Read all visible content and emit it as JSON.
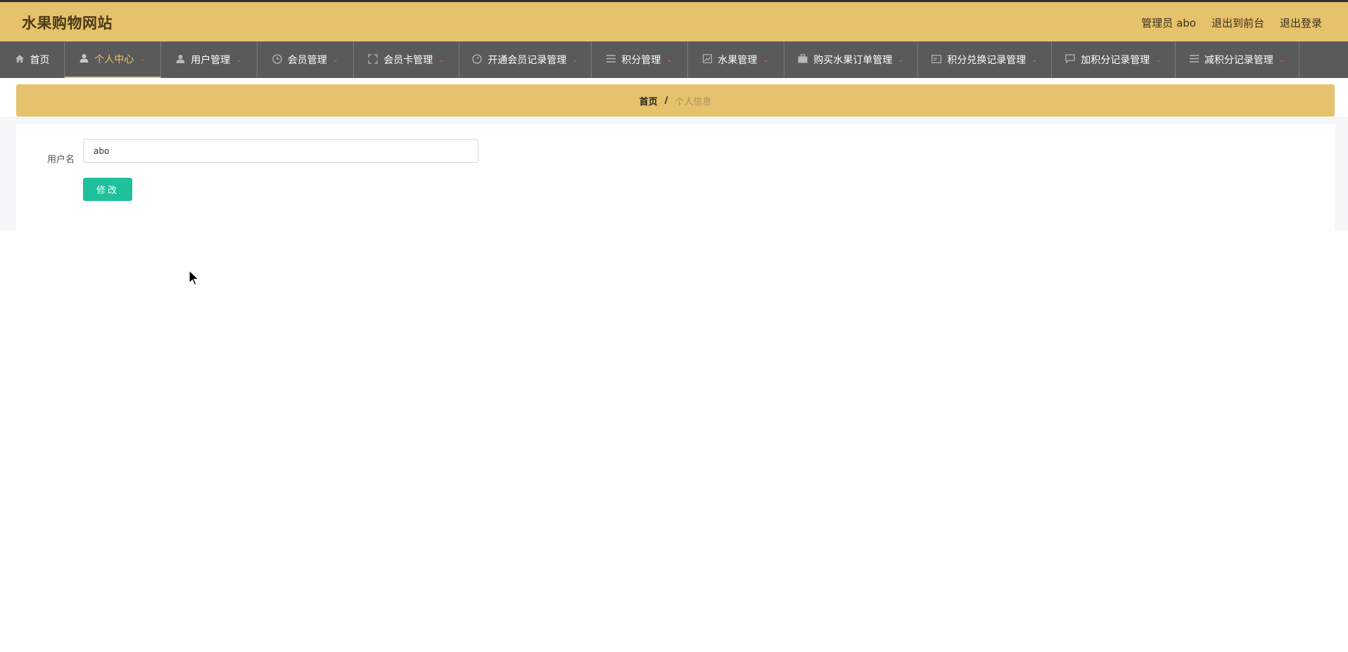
{
  "header": {
    "site_title": "水果购物网站",
    "admin_label": "管理员 abo",
    "exit_front_label": "退出到前台",
    "logout_label": "退出登录",
    "bg_color": "#e6c26c"
  },
  "nav": {
    "items": [
      {
        "label": "首页",
        "icon": "home-icon",
        "has_dropdown": false,
        "active": false
      },
      {
        "label": "个人中心",
        "icon": "user-icon",
        "has_dropdown": true,
        "active": true
      },
      {
        "label": "用户管理",
        "icon": "user-icon",
        "has_dropdown": true,
        "active": false
      },
      {
        "label": "会员管理",
        "icon": "clock-icon",
        "has_dropdown": true,
        "active": false
      },
      {
        "label": "会员卡管理",
        "icon": "expand-icon",
        "has_dropdown": true,
        "active": false
      },
      {
        "label": "开通会员记录管理",
        "icon": "dashboard-icon",
        "has_dropdown": true,
        "active": false
      },
      {
        "label": "积分管理",
        "icon": "list-icon",
        "has_dropdown": true,
        "active": false
      },
      {
        "label": "水果管理",
        "icon": "chart-icon",
        "has_dropdown": true,
        "active": false
      },
      {
        "label": "购买水果订单管理",
        "icon": "briefcase-icon",
        "has_dropdown": true,
        "active": false
      },
      {
        "label": "积分兑换记录管理",
        "icon": "card-icon",
        "has_dropdown": true,
        "active": false
      },
      {
        "label": "加积分记录管理",
        "icon": "message-icon",
        "has_dropdown": true,
        "active": false
      },
      {
        "label": "减积分记录管理",
        "icon": "list-icon",
        "has_dropdown": true,
        "active": false
      }
    ],
    "bg_color": "#5a5a5a",
    "active_color": "#f0c060"
  },
  "breadcrumb": {
    "home": "首页",
    "separator": "/",
    "current": "个人信息"
  },
  "form": {
    "username_label": "用户名",
    "username_value": "abo",
    "submit_label": "修改",
    "submit_color": "#1ec19c"
  }
}
